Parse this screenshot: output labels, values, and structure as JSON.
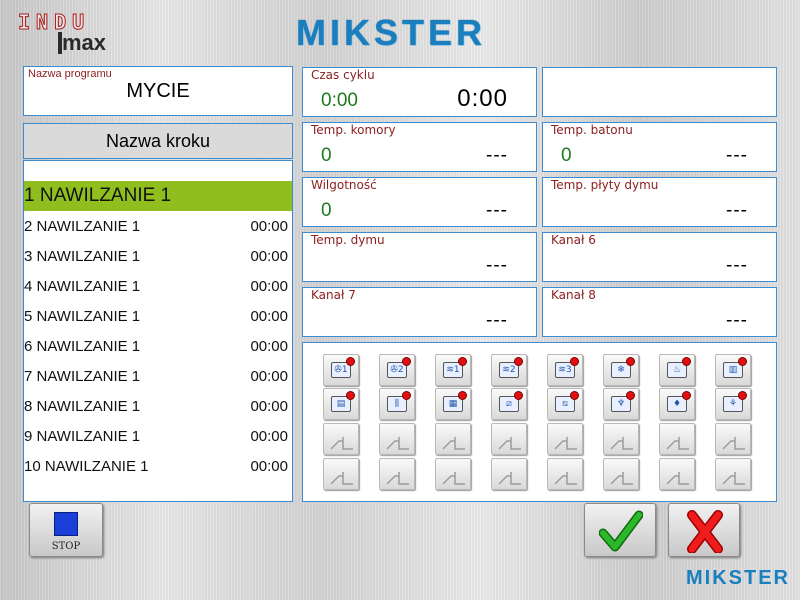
{
  "branding": {
    "indu": "INDU",
    "lmax": "max",
    "mikster": "MIKSTER",
    "mikster_small": "MIKSTER"
  },
  "program": {
    "label": "Nazwa programu",
    "name": "MYCIE"
  },
  "steps": {
    "header": "Nazwa kroku",
    "items": [
      {
        "name": "1 NAWILZANIE 1",
        "time": "",
        "active": true
      },
      {
        "name": "2 NAWILZANIE 1",
        "time": "00:00"
      },
      {
        "name": "3 NAWILZANIE 1",
        "time": "00:00"
      },
      {
        "name": "4 NAWILZANIE 1",
        "time": "00:00"
      },
      {
        "name": "5 NAWILZANIE 1",
        "time": "00:00"
      },
      {
        "name": "6 NAWILZANIE 1",
        "time": "00:00"
      },
      {
        "name": "7 NAWILZANIE 1",
        "time": "00:00"
      },
      {
        "name": "8 NAWILZANIE 1",
        "time": "00:00"
      },
      {
        "name": "9 NAWILZANIE 1",
        "time": "00:00"
      },
      {
        "name": "10 NAWILZANIE 1",
        "time": "00:00"
      }
    ]
  },
  "params": {
    "cycle": {
      "label": "Czas cyklu",
      "value": "0:00",
      "set": "0:00"
    },
    "blank": {
      "label": "",
      "value": "",
      "set": ""
    },
    "chamber_temp": {
      "label": "Temp. komory",
      "value": "0",
      "set": "---"
    },
    "core_temp": {
      "label": "Temp. batonu",
      "value": "0",
      "set": "---"
    },
    "humidity": {
      "label": "Wilgotność",
      "value": "0",
      "set": "---"
    },
    "smoke_plate_temp": {
      "label": "Temp. płyty dymu",
      "value": "",
      "set": "---"
    },
    "smoke_temp": {
      "label": "Temp. dymu",
      "value": "",
      "set": "---"
    },
    "channel6": {
      "label": "Kanał 6",
      "value": "",
      "set": "---"
    },
    "channel7": {
      "label": "Kanał 7",
      "value": "",
      "set": "---"
    },
    "channel8": {
      "label": "Kanał 8",
      "value": "",
      "set": "---"
    }
  },
  "function_icons": [
    "fan-1-icon",
    "fan-2-icon",
    "heater-1-icon",
    "heater-2-icon",
    "heater-3-icon",
    "cooling-icon",
    "steam-icon",
    "humidity-icon",
    "smoke-generator-icon",
    "shower-icon",
    "valve-icon",
    "damper-icon",
    "damper-2-icon",
    "burner-icon",
    "burner-2-icon",
    "spray-icon"
  ],
  "buttons": {
    "stop": "STOP"
  },
  "colors": {
    "accent_blue": "#3d8bd0",
    "active_step": "#90be1e",
    "label_red": "#8a1e1e",
    "value_green": "#1e7a1e",
    "stop_blue": "#1a3fd8",
    "ok_green": "#1e9a1e",
    "cancel_red": "#e01010"
  }
}
